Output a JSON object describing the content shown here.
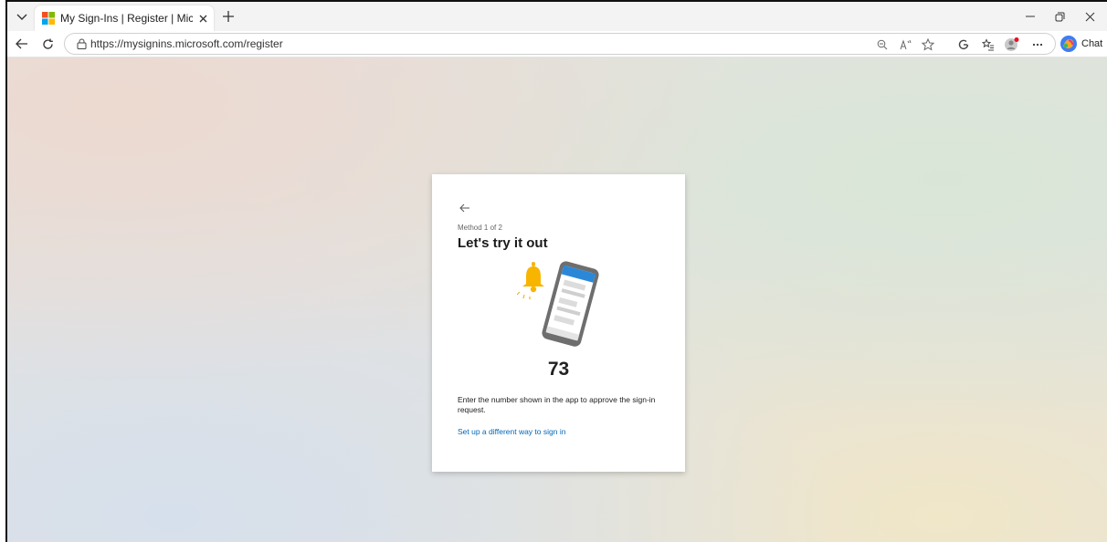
{
  "browser": {
    "tab": {
      "title": "My Sign-Ins | Register | Microsoft",
      "favicon": "microsoft-logo-icon"
    },
    "url": "https://mysignins.microsoft.com/register",
    "chat_label": "Chat",
    "icons": [
      "tab-list-icon",
      "close-icon",
      "plus-icon",
      "minimize-icon",
      "restore-icon",
      "back-icon",
      "refresh-icon",
      "site-info-icon",
      "zoom-icon",
      "read-aloud-icon",
      "favorite-icon",
      "copilot-icon",
      "favorites-icon",
      "profile-icon",
      "more-icon"
    ]
  },
  "card": {
    "method": "Method 1 of 2",
    "heading": "Let's try it out",
    "number": "73",
    "instruction": "Enter the number shown in the app to approve the sign-in request.",
    "alt_link": "Set up a different way to sign in"
  },
  "colors": {
    "link": "#0067b8",
    "bell": "#f7b500",
    "phone_header": "#2b88d8"
  }
}
